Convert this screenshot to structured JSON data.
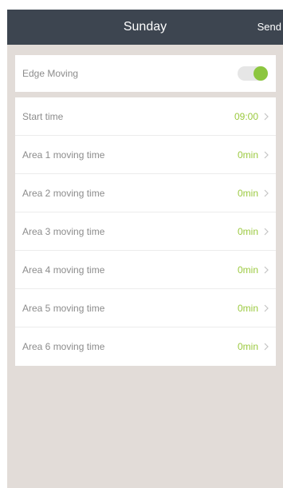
{
  "header": {
    "title": "Sunday",
    "send_label": "Send"
  },
  "edge_moving": {
    "label": "Edge Moving",
    "enabled": true
  },
  "rows": [
    {
      "label": "Start time",
      "value": "09:00"
    },
    {
      "label": "Area 1 moving time",
      "value": "0min"
    },
    {
      "label": "Area 2 moving time",
      "value": "0min"
    },
    {
      "label": "Area 3 moving time",
      "value": "0min"
    },
    {
      "label": "Area 4 moving time",
      "value": "0min"
    },
    {
      "label": "Area 5 moving time",
      "value": "0min"
    },
    {
      "label": "Area 6 moving time",
      "value": "0min"
    }
  ],
  "colors": {
    "nav_background": "#3d4550",
    "accent_green": "#9bc93f",
    "toggle_knob": "#8cc63f",
    "page_background": "#e2dcd8"
  }
}
